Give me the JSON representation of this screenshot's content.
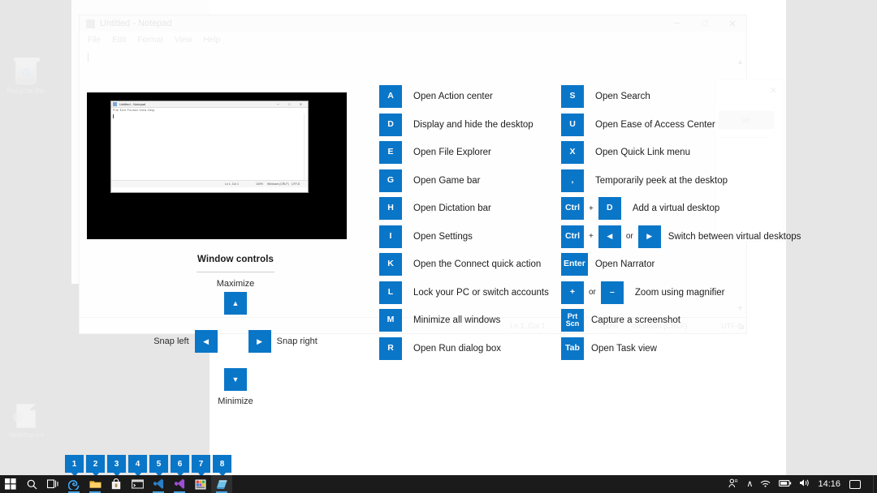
{
  "desktop": {
    "icons": [
      {
        "label": "Recycle Bin",
        "icon": "recycle-bin-icon"
      },
      {
        "label": "desktop.ini",
        "icon": "ini-file-icon"
      }
    ]
  },
  "notepad_window": {
    "title": "Untitled - Notepad",
    "menu": [
      "File",
      "Edit",
      "Format",
      "View",
      "Help"
    ],
    "controls": {
      "minimize": "─",
      "maximize": "□",
      "close": "✕"
    },
    "status": {
      "position": "Ln 1, Col 1",
      "zoom": "100%",
      "line_ending": "Windows (CRLF)",
      "encoding": "UTF-8"
    }
  },
  "save_dialog": {
    "close": "✕",
    "button_label": "ve"
  },
  "preview_thumbnail": {
    "title": "Untitled - Notepad",
    "menu": "File  Edit  Format  View  Help",
    "controls": "─ □ ✕",
    "status": {
      "position": "Ln 1, Col 1",
      "zoom": "100%",
      "line_ending": "Windows (CRLF)",
      "encoding": "UTF-8"
    }
  },
  "window_controls": {
    "title": "Window controls",
    "maximize_label": "Maximize",
    "minimize_label": "Minimize",
    "snap_left_label": "Snap left",
    "snap_right_label": "Snap right",
    "up_arrow": "▲",
    "down_arrow": "▼",
    "left_arrow": "◀",
    "right_arrow": "▶"
  },
  "shortcuts_left": [
    {
      "keys": [
        "A"
      ],
      "desc": "Open Action center"
    },
    {
      "keys": [
        "D"
      ],
      "desc": "Display and hide the desktop"
    },
    {
      "keys": [
        "E"
      ],
      "desc": "Open File Explorer"
    },
    {
      "keys": [
        "G"
      ],
      "desc": "Open Game bar"
    },
    {
      "keys": [
        "H"
      ],
      "desc": "Open Dictation bar"
    },
    {
      "keys": [
        "I"
      ],
      "desc": "Open Settings"
    },
    {
      "keys": [
        "K"
      ],
      "desc": "Open the Connect quick action"
    },
    {
      "keys": [
        "L"
      ],
      "desc": "Lock your PC or switch accounts"
    },
    {
      "keys": [
        "M"
      ],
      "desc": "Minimize all windows"
    },
    {
      "keys": [
        "R"
      ],
      "desc": "Open Run dialog box"
    }
  ],
  "shortcuts_right": [
    {
      "keys": [
        "S"
      ],
      "desc": "Open Search"
    },
    {
      "keys": [
        "U"
      ],
      "desc": "Open Ease of Access Center"
    },
    {
      "keys": [
        "X"
      ],
      "desc": "Open Quick Link menu"
    },
    {
      "keys": [
        ","
      ],
      "desc": "Temporarily peek at the desktop"
    },
    {
      "keys": [
        "Ctrl",
        "D"
      ],
      "sep": "+",
      "desc": "Add a virtual desktop"
    },
    {
      "keys": [
        "Ctrl",
        "◀",
        "▶"
      ],
      "sep": "+",
      "sep2": "or",
      "desc": "Switch between virtual desktops"
    },
    {
      "keys": [
        "Enter"
      ],
      "desc": "Open Narrator"
    },
    {
      "keys": [
        "+",
        "–"
      ],
      "sep": "or",
      "desc": "Zoom using magnifier"
    },
    {
      "keys": [
        "Prt\nScn"
      ],
      "desc": "Capture a screenshot"
    },
    {
      "keys": [
        "Tab"
      ],
      "desc": "Open Task view"
    }
  ],
  "taskbar_badges": [
    "1",
    "2",
    "3",
    "4",
    "5",
    "6",
    "7",
    "8"
  ],
  "taskbar": {
    "items": [
      {
        "name": "start-button",
        "glyph": "windows-logo-icon"
      },
      {
        "name": "search-button",
        "glyph": "search-icon"
      },
      {
        "name": "task-view-button",
        "glyph": "task-view-icon"
      },
      {
        "name": "edge-button",
        "glyph": "edge-icon",
        "running": true
      },
      {
        "name": "file-explorer-button",
        "glyph": "folder-icon",
        "running": true
      },
      {
        "name": "microsoft-store-button",
        "glyph": "store-icon"
      },
      {
        "name": "terminal-button",
        "glyph": "terminal-icon"
      },
      {
        "name": "vscode-button",
        "glyph": "vscode-icon",
        "running": true
      },
      {
        "name": "vscode-insiders-button",
        "glyph": "vscode-insiders-icon",
        "running": true
      },
      {
        "name": "app-button",
        "glyph": "colored-grid-icon"
      },
      {
        "name": "notepad-button",
        "glyph": "notepad-icon",
        "running": true,
        "active": true
      }
    ],
    "tray": {
      "people": "·",
      "chevron": "∧",
      "network": "network-icon",
      "battery": "battery-icon",
      "volume": "volume-icon",
      "clock": "14:16",
      "notifications": "notification-center-icon"
    }
  },
  "colors": {
    "accent": "#0a76c8",
    "taskbar": "#1b1b1b",
    "desktop_gray": "#e6e6e6",
    "preview_black": "#000000"
  }
}
